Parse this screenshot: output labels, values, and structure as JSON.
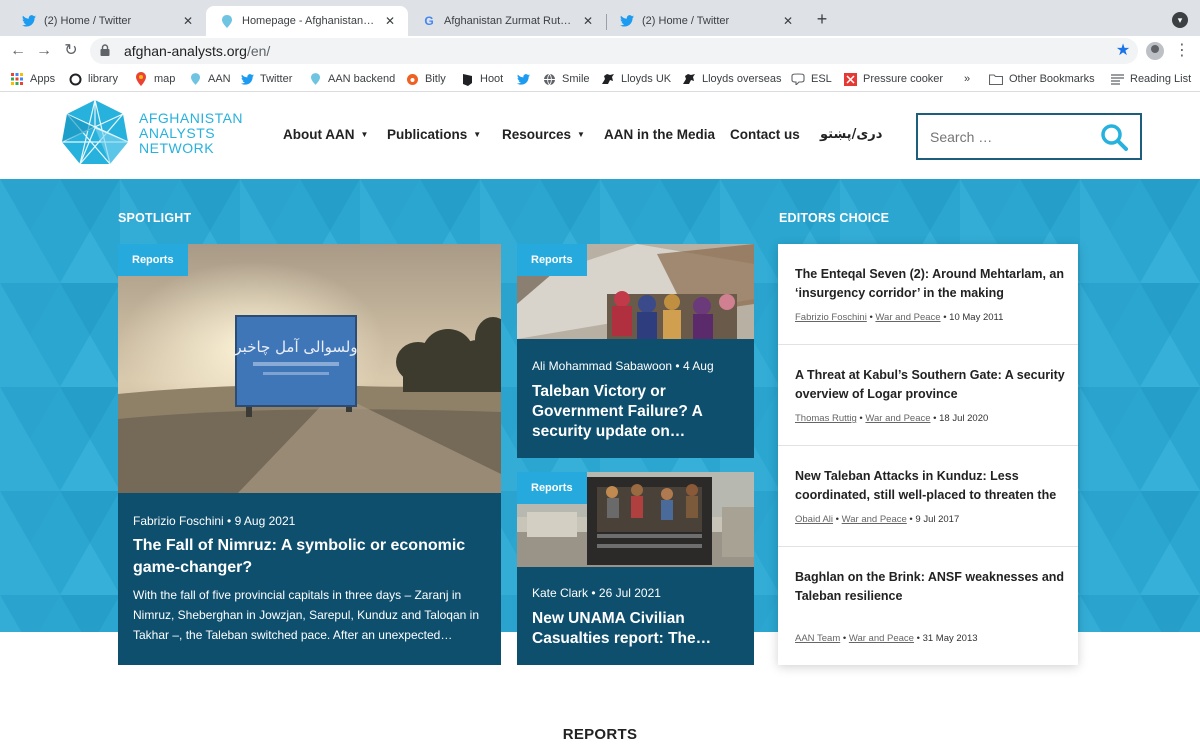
{
  "browser": {
    "tabs": [
      {
        "title": "(2) Home / Twitter",
        "icon": "twitter-icon"
      },
      {
        "title": "Homepage - Afghanistan Analysts Network",
        "icon": "aan-icon"
      },
      {
        "title": "Afghanistan Zurmat Ruttig - Google Search",
        "icon": "google-icon"
      },
      {
        "title": "(2) Home / Twitter",
        "icon": "twitter-icon"
      }
    ],
    "url_host": "afghan-analysts.org",
    "url_path": "/en/",
    "bookmarks": [
      "Apps",
      "library",
      "map",
      "AAN",
      "Twitter",
      "AAN backend",
      "Bitly",
      "Hoot",
      "",
      "Smile",
      "Lloyds UK",
      "Lloyds overseas",
      "ESL",
      "Pressure cooker"
    ],
    "bookmarks_overflow": "»",
    "other_bookmarks": "Other Bookmarks",
    "reading_list": "Reading List"
  },
  "site": {
    "logo": [
      "AFGHANISTAN",
      "ANALYSTS",
      "NETWORK"
    ],
    "nav": [
      "About AAN",
      "Publications",
      "Resources",
      "AAN in the Media",
      "Contact us",
      "دری/پښتو"
    ],
    "search_placeholder": "Search …",
    "brand_color": "#27b1dd"
  },
  "spotlight": {
    "label": "SPOTLIGHT",
    "main": {
      "tag": "Reports",
      "sign_text": "ولسوالی آمل چاخبر",
      "meta": "Fabrizio Foschini • 9 Aug 2021",
      "title": "The Fall of Nimruz: A symbolic or economic game-changer?",
      "excerpt": "With the fall of five provincial capitals in three days – Zaranj in Nimruz, Sheberghan in Jowzjan, Sarepul, Kunduz and Taloqan in Takhar –, the Taleban switched pace. After an unexpected…"
    },
    "side": [
      {
        "tag": "Reports",
        "meta": "Ali Mohammad Sabawoon • 4 Aug",
        "title": "Taleban Victory or Government Failure? A security update on…"
      },
      {
        "tag": "Reports",
        "meta": "Kate Clark • 26 Jul 2021",
        "title": "New UNAMA Civilian Casualties report: The…"
      }
    ]
  },
  "editors": {
    "label": "EDITORS CHOICE",
    "items": [
      {
        "title": "The Enteqal Seven (2): Around Mehtarlam, an ‘insurgency corridor’ in the making",
        "author": "Fabrizio Foschini",
        "category": "War and Peace",
        "date": "10 May 2011"
      },
      {
        "title": "A Threat at Kabul’s Southern Gate: A security overview of Logar province",
        "author": "Thomas Ruttig",
        "category": "War and Peace",
        "date": "18 Jul 2020"
      },
      {
        "title": "New Taleban Attacks in Kunduz: Less coordinated, still well-placed to threaten the",
        "author": "Obaid Ali",
        "category": "War and Peace",
        "date": "9 Jul 2017"
      },
      {
        "title": "Baghlan on the Brink: ANSF weaknesses and Taleban resilience",
        "author": "AAN Team",
        "category": "War and Peace",
        "date": "31 May 2013"
      }
    ]
  },
  "reports_heading": "REPORTS"
}
